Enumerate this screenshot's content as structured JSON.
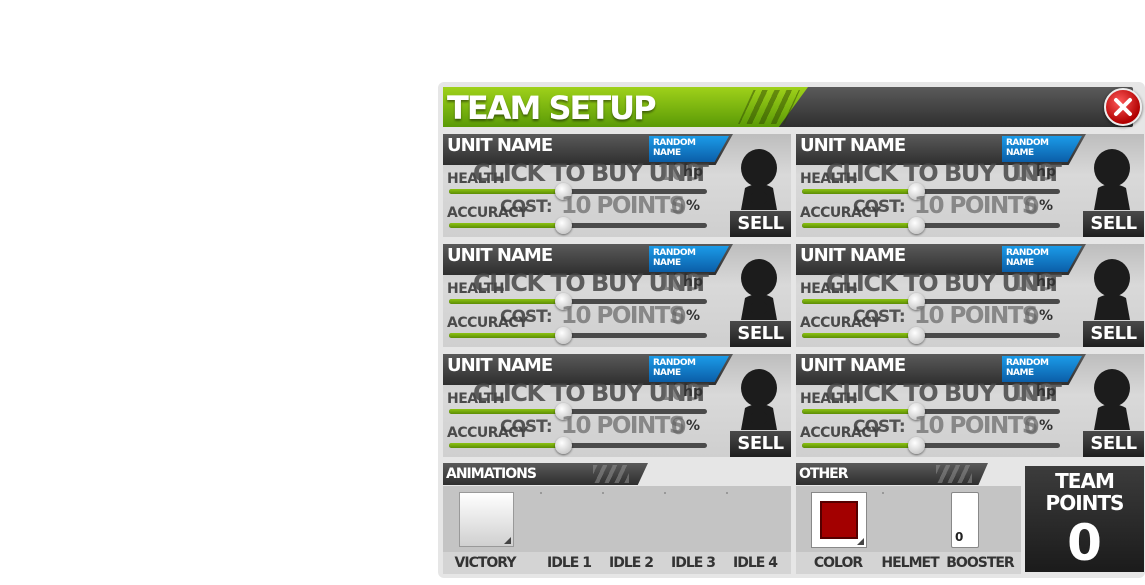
{
  "dialog": {
    "title": "TEAM SETUP"
  },
  "units": [
    {
      "name": "UNIT NAME",
      "random_label": "RANDOM NAME",
      "health_label": "HEALTH",
      "accuracy_label": "ACCURACY",
      "buy_text": "CLICK TO BUY UNIT",
      "cost_label": "COST:",
      "cost_value": "10 POINTS",
      "health_value": "100",
      "health_unit": "hp",
      "accuracy_value": "0",
      "accuracy_unit": "%",
      "health_level": 0.44,
      "accuracy_level": 0.44,
      "sell_label": "SELL"
    },
    {
      "name": "UNIT NAME",
      "random_label": "RANDOM NAME",
      "health_label": "HEALTH",
      "accuracy_label": "ACCURACY",
      "buy_text": "CLICK TO BUY UNIT",
      "cost_label": "COST:",
      "cost_value": "10 POINTS",
      "health_value": "100",
      "health_unit": "hp",
      "accuracy_value": "0",
      "accuracy_unit": "%",
      "health_level": 0.44,
      "accuracy_level": 0.44,
      "sell_label": "SELL"
    },
    {
      "name": "UNIT NAME",
      "random_label": "RANDOM NAME",
      "health_label": "HEALTH",
      "accuracy_label": "ACCURACY",
      "buy_text": "CLICK TO BUY UNIT",
      "cost_label": "COST:",
      "cost_value": "10 POINTS",
      "health_value": "100",
      "health_unit": "hp",
      "accuracy_value": "0",
      "accuracy_unit": "%",
      "health_level": 0.44,
      "accuracy_level": 0.44,
      "sell_label": "SELL"
    },
    {
      "name": "UNIT NAME",
      "random_label": "RANDOM NAME",
      "health_label": "HEALTH",
      "accuracy_label": "ACCURACY",
      "buy_text": "CLICK TO BUY UNIT",
      "cost_label": "COST:",
      "cost_value": "10 POINTS",
      "health_value": "100",
      "health_unit": "hp",
      "accuracy_value": "0",
      "accuracy_unit": "%",
      "health_level": 0.44,
      "accuracy_level": 0.44,
      "sell_label": "SELL"
    },
    {
      "name": "UNIT NAME",
      "random_label": "RANDOM NAME",
      "health_label": "HEALTH",
      "accuracy_label": "ACCURACY",
      "buy_text": "CLICK TO BUY UNIT",
      "cost_label": "COST:",
      "cost_value": "10 POINTS",
      "health_value": "100",
      "health_unit": "hp",
      "accuracy_value": "0",
      "accuracy_unit": "%",
      "health_level": 0.44,
      "accuracy_level": 0.44,
      "sell_label": "SELL"
    },
    {
      "name": "UNIT NAME",
      "random_label": "RANDOM NAME",
      "health_label": "HEALTH",
      "accuracy_label": "ACCURACY",
      "buy_text": "CLICK TO BUY UNIT",
      "cost_label": "COST:",
      "cost_value": "10 POINTS",
      "health_value": "100",
      "health_unit": "hp",
      "accuracy_value": "0",
      "accuracy_unit": "%",
      "health_level": 0.44,
      "accuracy_level": 0.44,
      "sell_label": "SELL"
    }
  ],
  "animations": {
    "title": "ANIMATIONS",
    "slots": [
      "VICTORY",
      "IDLE 1",
      "IDLE 2",
      "IDLE 3",
      "IDLE 4"
    ]
  },
  "other": {
    "title": "OTHER",
    "slots": [
      "COLOR",
      "HELMET",
      "BOOSTER"
    ],
    "color_value": "#a30000",
    "booster_value": "0"
  },
  "team_points": {
    "label_line1": "TEAM",
    "label_line2": "POINTS",
    "value": "0"
  },
  "colors": {
    "accent_green": "#7fbf10",
    "random_badge_blue": "#1b8fdc",
    "close_red": "#d40000"
  },
  "icons": [
    "close-icon",
    "silhouette-icon",
    "dropdown-corner-icon"
  ]
}
